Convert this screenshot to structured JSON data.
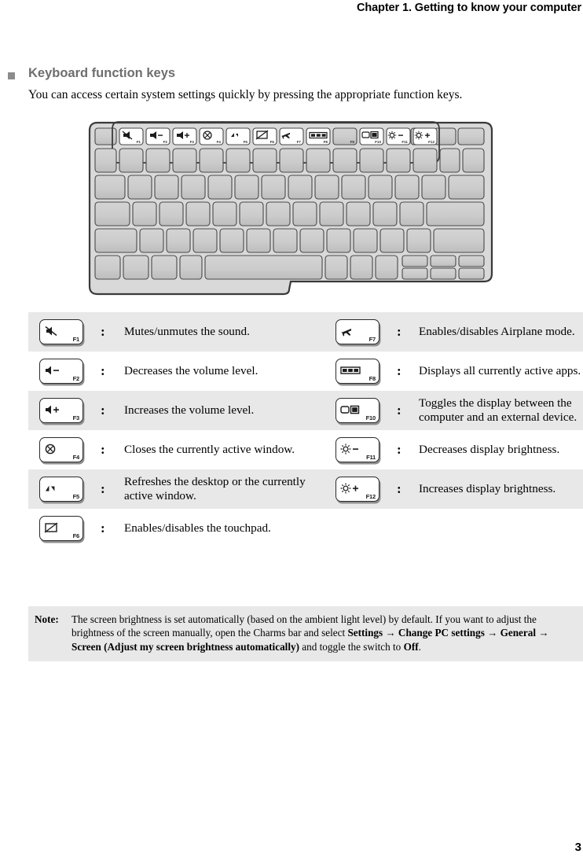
{
  "header": {
    "running_title": "Chapter 1. Getting to know your computer"
  },
  "section": {
    "title": "Keyboard function keys",
    "intro": "You can access certain system settings quickly by pressing the appropriate function keys."
  },
  "keyboard_illustration": {
    "highlighted_function_keys": [
      "F1",
      "F2",
      "F3",
      "F4",
      "F5",
      "F6",
      "F7",
      "F8",
      "F10",
      "F11",
      "F12"
    ],
    "dimmed_function_keys": [
      "F9"
    ],
    "fn_key_glyphs": [
      {
        "key": "F1",
        "glyph": "mute-icon"
      },
      {
        "key": "F2",
        "glyph": "volume-down-icon"
      },
      {
        "key": "F3",
        "glyph": "volume-up-icon"
      },
      {
        "key": "F4",
        "glyph": "close-window-icon"
      },
      {
        "key": "F5",
        "glyph": "refresh-icon"
      },
      {
        "key": "F6",
        "glyph": "touchpad-off-icon"
      },
      {
        "key": "F7",
        "glyph": "airplane-icon"
      },
      {
        "key": "F8",
        "glyph": "active-apps-icon"
      },
      {
        "key": "F9",
        "glyph": "none"
      },
      {
        "key": "F10",
        "glyph": "display-toggle-icon"
      },
      {
        "key": "F11",
        "glyph": "brightness-down-icon"
      },
      {
        "key": "F12",
        "glyph": "brightness-up-icon"
      }
    ]
  },
  "function_key_table": {
    "colon": ":",
    "rows": [
      {
        "shaded": true,
        "left": {
          "key": "F1",
          "icon": "mute-icon",
          "description": "Mutes/unmutes the sound."
        },
        "right": {
          "key": "F7",
          "icon": "airplane-icon",
          "description": "Enables/disables Airplane mode."
        }
      },
      {
        "shaded": false,
        "left": {
          "key": "F2",
          "icon": "volume-down-icon",
          "description": "Decreases the volume level."
        },
        "right": {
          "key": "F8",
          "icon": "active-apps-icon",
          "description": "Displays all currently active apps."
        }
      },
      {
        "shaded": true,
        "left": {
          "key": "F3",
          "icon": "volume-up-icon",
          "description": "Increases the volume level."
        },
        "right": {
          "key": "F10",
          "icon": "display-toggle-icon",
          "description": "Toggles the display between the computer and an external device."
        }
      },
      {
        "shaded": false,
        "left": {
          "key": "F4",
          "icon": "close-window-icon",
          "description": "Closes the currently active window."
        },
        "right": {
          "key": "F11",
          "icon": "brightness-down-icon",
          "description": "Decreases display brightness."
        }
      },
      {
        "shaded": true,
        "left": {
          "key": "F5",
          "icon": "refresh-icon",
          "description": "Refreshes the desktop or the currently active window."
        },
        "right": {
          "key": "F12",
          "icon": "brightness-up-icon",
          "description": "Increases display brightness."
        }
      },
      {
        "shaded": false,
        "left": {
          "key": "F6",
          "icon": "touchpad-off-icon",
          "description": "Enables/disables the touchpad."
        },
        "right": {
          "key": "",
          "icon": "",
          "description": ""
        }
      }
    ]
  },
  "note": {
    "label": "Note:",
    "text_part1": "The screen brightness is set automatically (based on the ambient light level) by default. If you want to adjust the brightness of the screen manually, open the Charms bar and select ",
    "bold1": "Settings",
    "arrow1": " → ",
    "bold2": "Change PC settings",
    "arrow2": " → ",
    "bold3": "General",
    "arrow3": " → ",
    "bold4": "Screen (Adjust my screen brightness automatically)",
    "text_part2": " and toggle the switch to ",
    "bold5": "Off",
    "text_part3": "."
  },
  "page_number": "3",
  "colors": {
    "heading_gray": "#6e6e6e",
    "bullet_gray": "#8c8c8c",
    "row_shade": "#e8e8e8",
    "note_bg": "#e8e8e8",
    "key_outline": "#2b2b2b"
  }
}
